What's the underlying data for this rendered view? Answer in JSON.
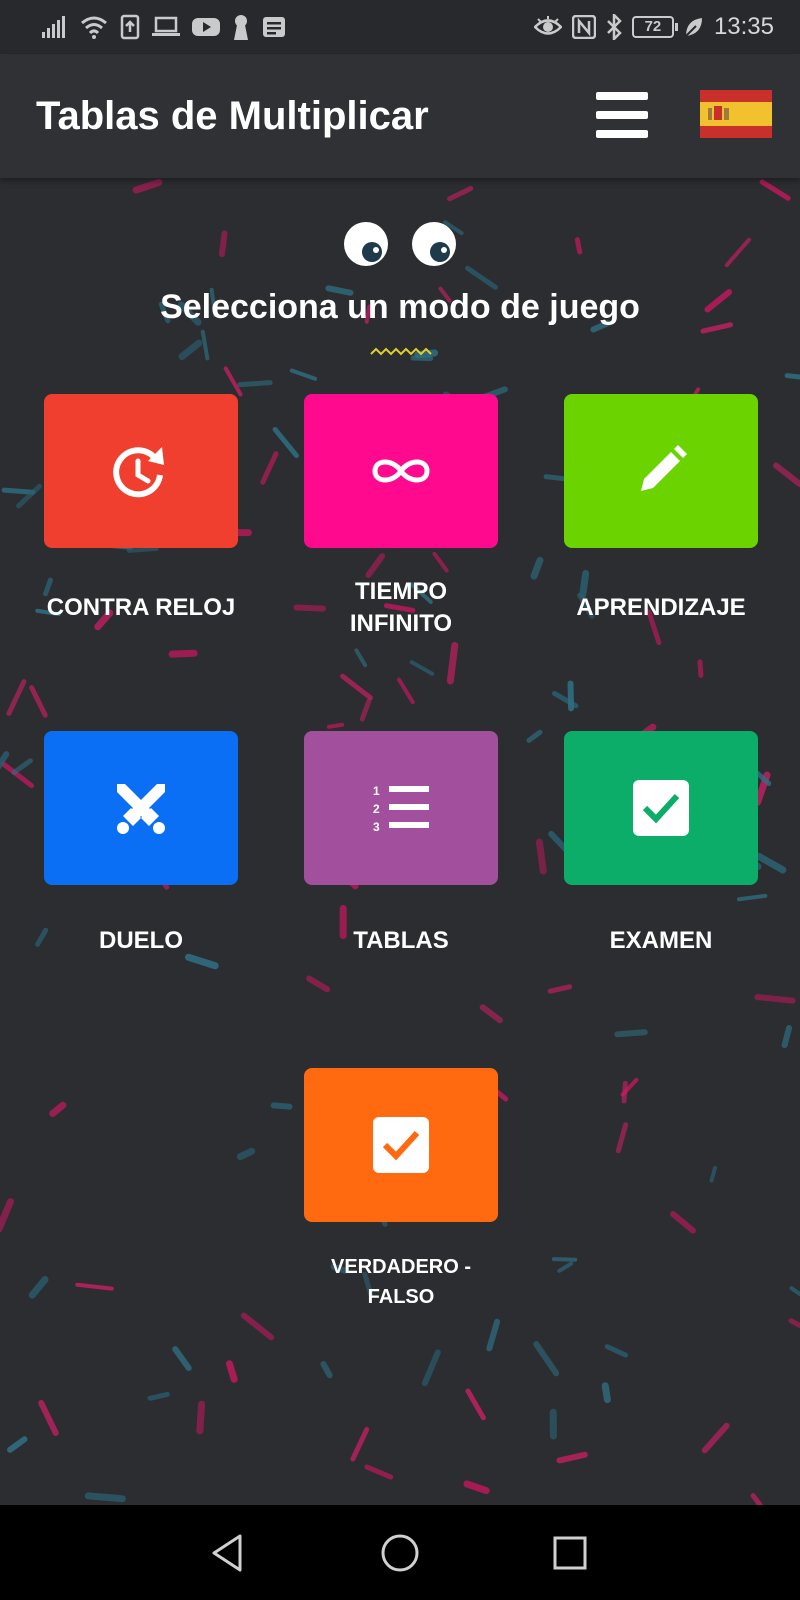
{
  "status_bar": {
    "time": "13:35",
    "battery": "72",
    "icons": [
      "signal-icon",
      "wifi-icon",
      "upload-icon",
      "laptop-icon",
      "youtube-icon",
      "keyhole-icon",
      "message-icon",
      "eye-icon",
      "nfc-icon",
      "bluetooth-icon",
      "battery-icon",
      "leaf-icon"
    ]
  },
  "app_bar": {
    "title": "Tablas de Multiplicar",
    "menu_icon": "hamburger-menu-icon",
    "language_icon": "spain-flag-icon"
  },
  "main": {
    "heading": "Selecciona un modo de juego",
    "modes": [
      {
        "label": "CONTRA RELOJ",
        "color": "#f03e2f",
        "icon": "timer-restart-icon"
      },
      {
        "label": "TIEMPO\nINFINITO",
        "color": "#ff0a8f",
        "icon": "infinity-icon"
      },
      {
        "label": "APRENDIZAJE",
        "color": "#6ad300",
        "icon": "pencil-icon"
      },
      {
        "label": "DUELO",
        "color": "#0a6ff5",
        "icon": "crossed-swords-icon"
      },
      {
        "label": "TABLAS",
        "color": "#a24f9d",
        "icon": "numbered-list-icon"
      },
      {
        "label": "EXAMEN",
        "color": "#0bad68",
        "icon": "checkbox-icon"
      },
      {
        "label": "VERDADERO -\nFALSO",
        "color": "#ff6a10",
        "icon": "checkbox-icon"
      }
    ]
  },
  "nav_bar": {
    "icons": [
      "back-triangle-icon",
      "home-circle-icon",
      "recents-square-icon"
    ]
  }
}
